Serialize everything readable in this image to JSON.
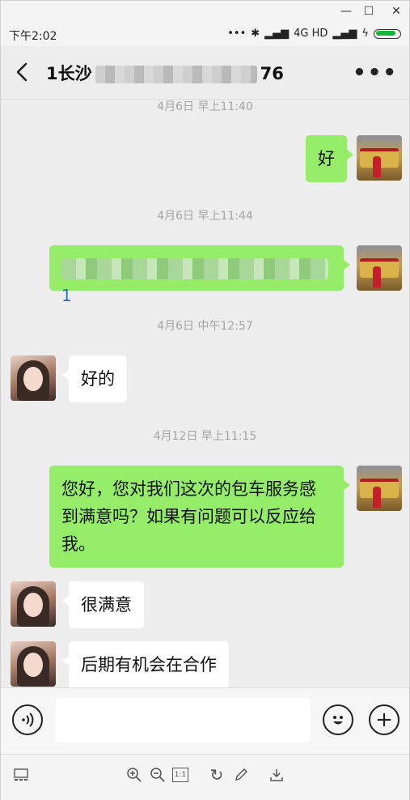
{
  "window": {
    "minimize_label": "—",
    "maximize_label": "☐",
    "close_label": "✕"
  },
  "status_bar": {
    "time": "下午2:02",
    "network": "4G HD",
    "dots": "•••"
  },
  "header": {
    "title_prefix": "1长沙",
    "title_suffix": "76",
    "more_label": "•••"
  },
  "messages": [
    {
      "timestamp": "4月6日 早上11:40"
    },
    {
      "sender": "me",
      "text": "好"
    },
    {
      "timestamp": "4月6日 早上11:44"
    },
    {
      "sender": "me",
      "text_tail": "1"
    },
    {
      "timestamp": "4月6日 中午12:57"
    },
    {
      "sender": "them",
      "text": "好的"
    },
    {
      "timestamp": "4月12日 早上11:15"
    },
    {
      "sender": "me",
      "lines": [
        "您好，您对我们这次的包车服务感",
        "到满意吗？如果有问题可以反应给",
        "我。"
      ]
    },
    {
      "sender": "them",
      "text": "很满意"
    },
    {
      "sender": "them",
      "text": "后期有机会在合作"
    }
  ],
  "input_bar": {
    "voice_icon": "voice-icon",
    "emoji_icon": "emoji-icon",
    "plus_icon": "plus-icon",
    "input_value": ""
  },
  "viewer_toolbar": {
    "icons": [
      "thumbnail-icon",
      "zoom-in-icon",
      "zoom-out-icon",
      "actual-size-icon",
      "rotate-icon",
      "edit-icon",
      "download-icon"
    ],
    "actual_size_label": "1:1"
  },
  "colors": {
    "my_bubble": "#95ec69",
    "their_bubble": "#ffffff",
    "background": "#ededed"
  }
}
